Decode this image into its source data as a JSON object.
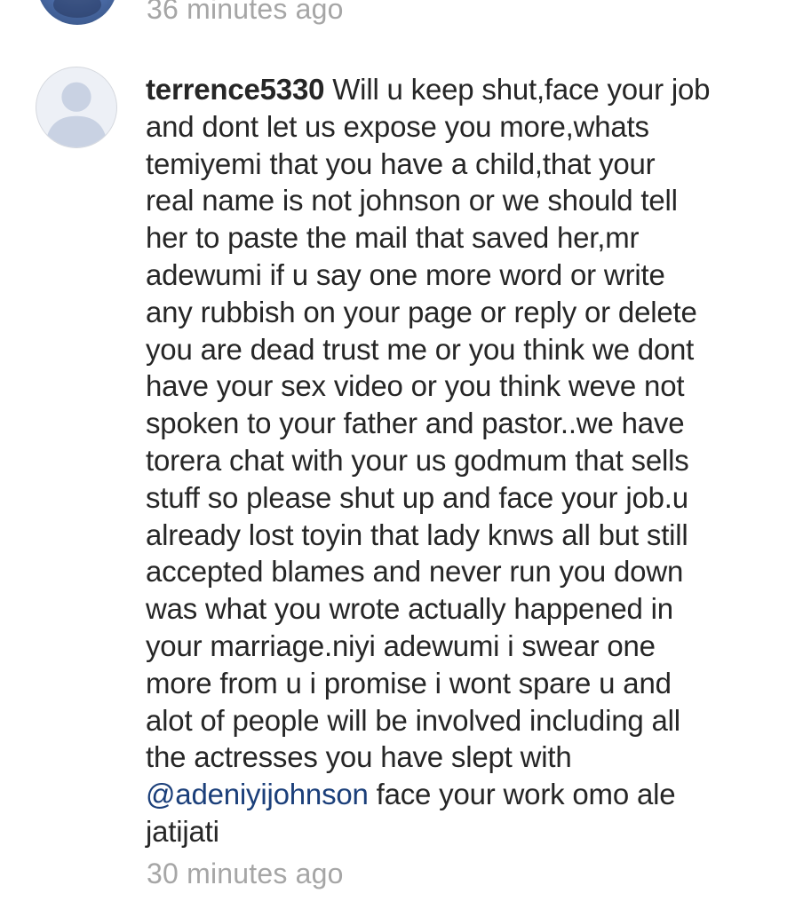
{
  "previous_comment": {
    "timestamp": "36 minutes ago"
  },
  "comment": {
    "username": "terrence5330",
    "first_line_text": "Will u keep shut,face your job",
    "lines": [
      "and dont let us expose you more,whats",
      "temiyemi that you have a child,that your",
      "real name is not johnson or we should tell",
      "her to paste the mail that saved her,mr",
      "adewumi if u say one more word or write",
      "any rubbish on your page or reply or delete",
      "you are dead trust me or you think we dont",
      "have your sex video or you think weve not",
      "spoken to your father and pastor..we have",
      "torera chat with your us godmum that sells",
      "stuff so please shut up and face your job.u",
      "already lost toyin that lady knws all but still",
      "accepted blames and never run you down",
      "was what you wrote actually happened in",
      "your marriage.niyi adewumi i swear one",
      "more from u i promise i wont spare u and",
      "alot of people will be involved including all",
      "the actresses you have slept with"
    ],
    "mention": "@adeniyijohnson",
    "after_mention": " face your work omo ale",
    "last_line": "jatijati",
    "timestamp": "30 minutes ago"
  },
  "colors": {
    "text": "#262626",
    "muted": "#a6a6a6",
    "mention": "#1b3f7a",
    "avatar_bg": "#edf0f6",
    "avatar_figure": "#c9d2e3"
  },
  "icons": {
    "default_avatar": "user-silhouette-icon"
  }
}
